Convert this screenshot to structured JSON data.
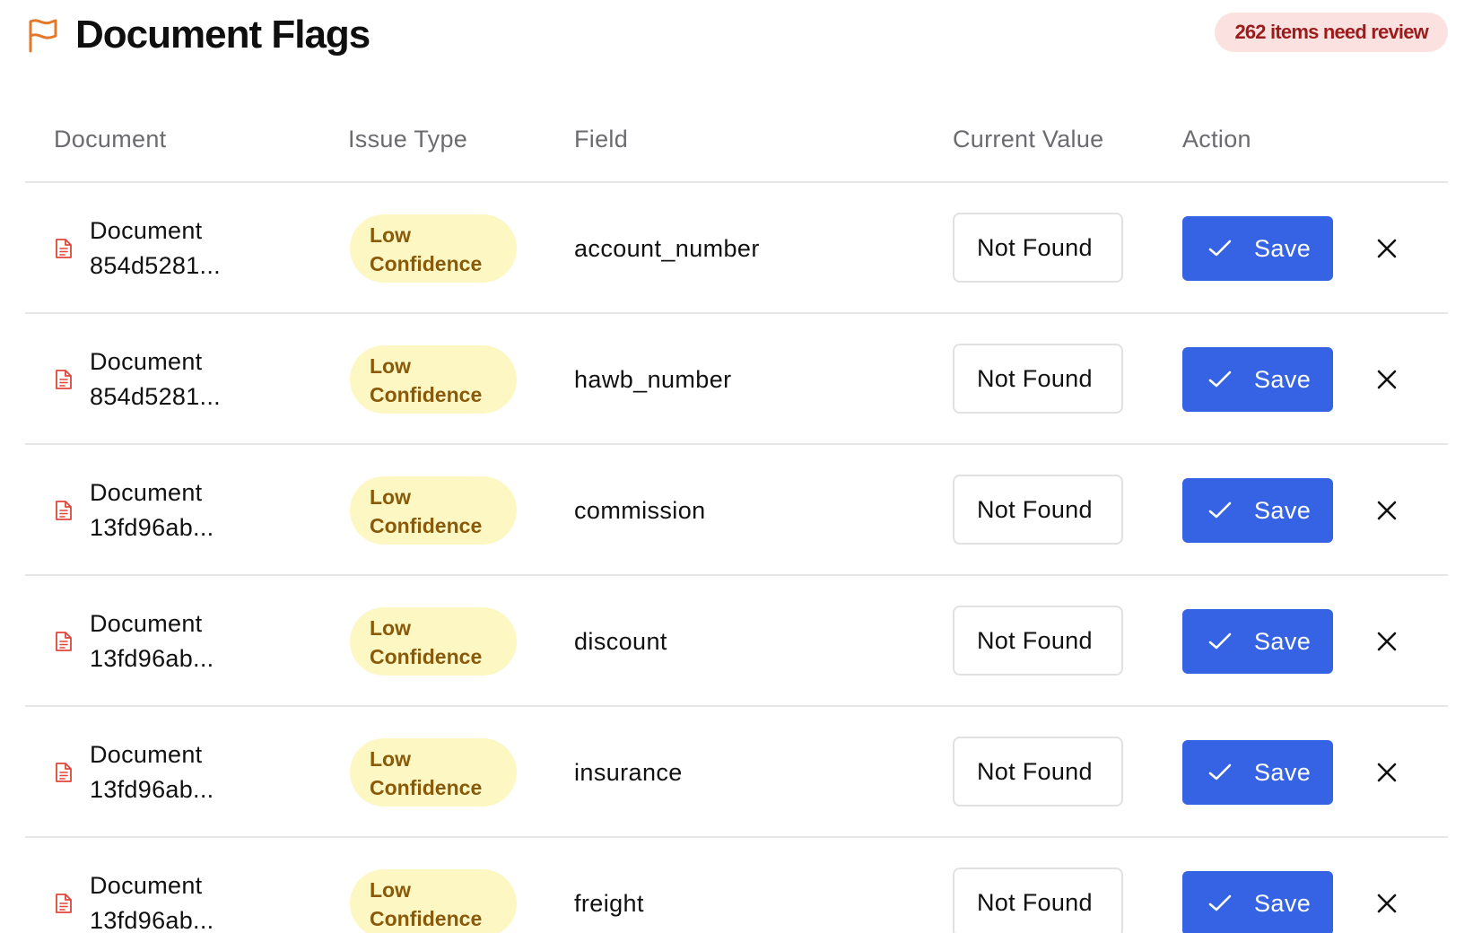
{
  "header": {
    "title": "Document Flags",
    "review_badge": "262 items need review",
    "flag_icon": "flag-icon"
  },
  "colors": {
    "accent": "#3563e4",
    "flag": "#e4782a",
    "badge_bg": "#fce1e1",
    "badge_text": "#9b1c1c",
    "issue_bg": "#fdf7c3",
    "issue_text": "#8a5a0b",
    "doc_icon": "#e0463a"
  },
  "table": {
    "columns": [
      "Document",
      "Issue Type",
      "Field",
      "Current Value",
      "Action"
    ],
    "rows": [
      {
        "document": "Document 854d5281...",
        "issue_type": "Low Confidence",
        "field": "account_number",
        "current_value": "Not Found",
        "save_label": "Save"
      },
      {
        "document": "Document 854d5281...",
        "issue_type": "Low Confidence",
        "field": "hawb_number",
        "current_value": "Not Found",
        "save_label": "Save"
      },
      {
        "document": "Document 13fd96ab...",
        "issue_type": "Low Confidence",
        "field": "commission",
        "current_value": "Not Found",
        "save_label": "Save"
      },
      {
        "document": "Document 13fd96ab...",
        "issue_type": "Low Confidence",
        "field": "discount",
        "current_value": "Not Found",
        "save_label": "Save"
      },
      {
        "document": "Document 13fd96ab...",
        "issue_type": "Low Confidence",
        "field": "insurance",
        "current_value": "Not Found",
        "save_label": "Save"
      },
      {
        "document": "Document 13fd96ab...",
        "issue_type": "Low Confidence",
        "field": "freight",
        "current_value": "Not Found",
        "save_label": "Save"
      }
    ]
  }
}
